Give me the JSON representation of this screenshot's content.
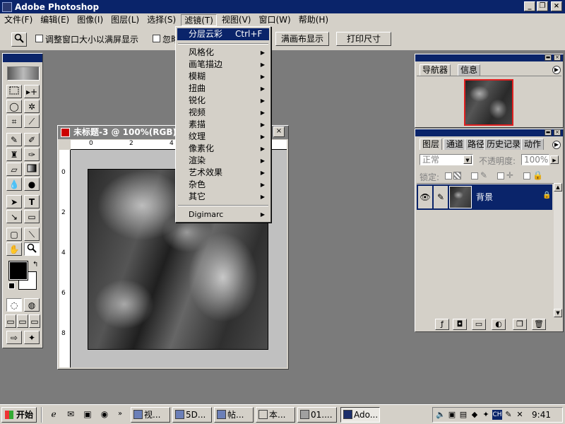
{
  "app": {
    "title": "Adobe Photoshop",
    "window_buttons": [
      "_",
      "❐",
      "×"
    ]
  },
  "menubar": [
    "文件(F)",
    "编辑(E)",
    "图像(I)",
    "图层(L)",
    "选择(S)",
    "滤镜(T)",
    "视图(V)",
    "窗口(W)",
    "帮助(H)"
  ],
  "options": {
    "tool_icon": "zoom-icon",
    "checkbox1_label": "调整窗口大小以满屏显示",
    "checkbox2_label": "忽略",
    "fit_button": "满画布显示",
    "print_button": "打印尺寸"
  },
  "filter_menu": {
    "last_filter": "分层云彩",
    "last_filter_shortcut": "Ctrl+F",
    "items": [
      "风格化",
      "画笔描边",
      "模糊",
      "扭曲",
      "锐化",
      "视频",
      "素描",
      "纹理",
      "像素化",
      "渲染",
      "艺术效果",
      "杂色",
      "其它"
    ],
    "digimarc": "Digimarc"
  },
  "document": {
    "title": "未标题-3 @ 100%(RGB)",
    "ruler_top": [
      "0",
      "2",
      "4"
    ],
    "ruler_left": [
      "0",
      "2",
      "4",
      "6",
      "8"
    ]
  },
  "navigator": {
    "tabs": [
      "导航器",
      "信息"
    ]
  },
  "layers": {
    "tabs": [
      "图层",
      "通道",
      "路径",
      "历史记录",
      "动作"
    ],
    "blend_mode": "正常",
    "opacity_label": "不透明度:",
    "opacity_value": "100%",
    "lock_label": "锁定:",
    "layer_name": "背景"
  },
  "taskbar": {
    "start": "开始",
    "tasks": [
      "视...",
      "5D...",
      "帖...",
      "本...",
      "01....",
      "Ado..."
    ],
    "clock": "9:41",
    "tray_ime": "CH"
  }
}
